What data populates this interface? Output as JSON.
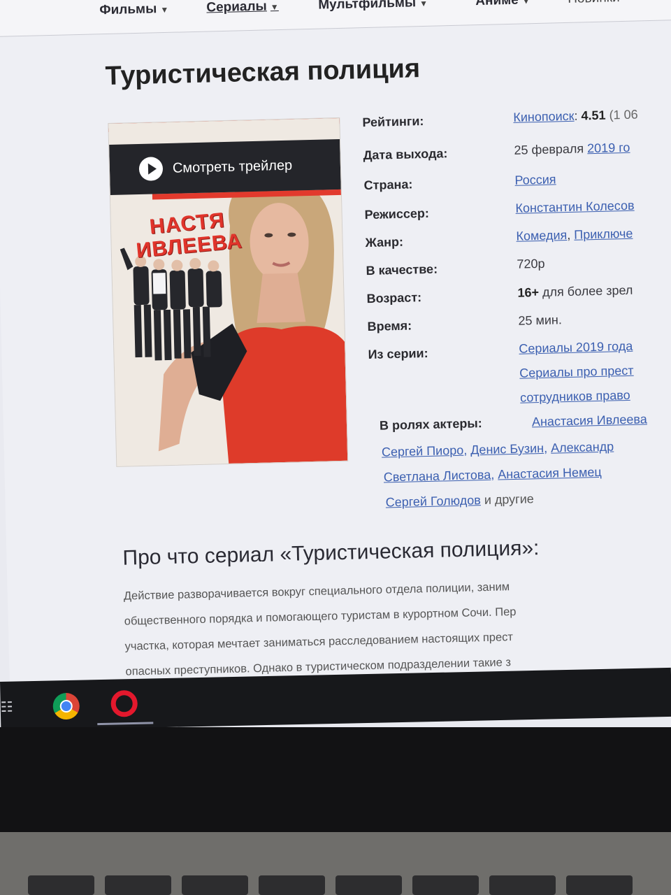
{
  "nav": {
    "items": [
      {
        "label": "Фильмы"
      },
      {
        "label": "Сериалы"
      },
      {
        "label": "Мультфильмы"
      },
      {
        "label": "Аниме"
      },
      {
        "label": "Новинки"
      }
    ]
  },
  "title": "Туристическая полиция",
  "poster": {
    "trailer_label": "Смотреть трейлер",
    "name_line1": "НАСТЯ",
    "name_line2": "ИВЛЕЕВА"
  },
  "info": {
    "ratings_label": "Рейтинги:",
    "ratings_source": "Кинопоиск",
    "ratings_value": "4.51",
    "ratings_extra": "(1 06",
    "release_label": "Дата выхода:",
    "release_date": "25 февраля",
    "release_year": "2019 го",
    "country_label": "Страна:",
    "country_value": "Россия",
    "director_label": "Режиссер:",
    "director_value": "Константин Колесов",
    "genre_label": "Жанр:",
    "genre_1": "Комедия",
    "genre_2": "Приключе",
    "quality_label": "В качестве:",
    "quality_value": "720p",
    "age_label": "Возраст:",
    "age_value": "16+",
    "age_note": "для более зрел",
    "time_label": "Время:",
    "time_value": "25 мин.",
    "series_label": "Из серии:",
    "series_1": "Сериалы 2019 года",
    "series_2": "Сериалы про прест",
    "series_3": "сотрудников право"
  },
  "cast": {
    "label": "В ролях актеры:",
    "actor_1": "Анастасия Ивлеева",
    "actor_2": "Сергей Пиоро",
    "actor_3": "Денис Бузин",
    "actor_4": "Александр",
    "actor_5": "Светлана Листова",
    "actor_6": "Анастасия Немец",
    "actor_7": "Сергей Голюдов",
    "others": "и другие"
  },
  "about": {
    "title": "Про что сериал «Туристическая полиция»:",
    "line_1": "Действие разворачивается вокруг специального отдела полиции, заним",
    "line_2": "общественного порядка и помогающего туристам в курортном Сочи. Пер",
    "line_3": "участка, которая мечтает заниматься расследованием настоящих прест",
    "line_4": "опасных преступников. Однако в туристическом подразделении такие з"
  },
  "taskbar": {
    "icons": [
      "task-view-icon",
      "chrome-icon",
      "opera-icon"
    ]
  }
}
